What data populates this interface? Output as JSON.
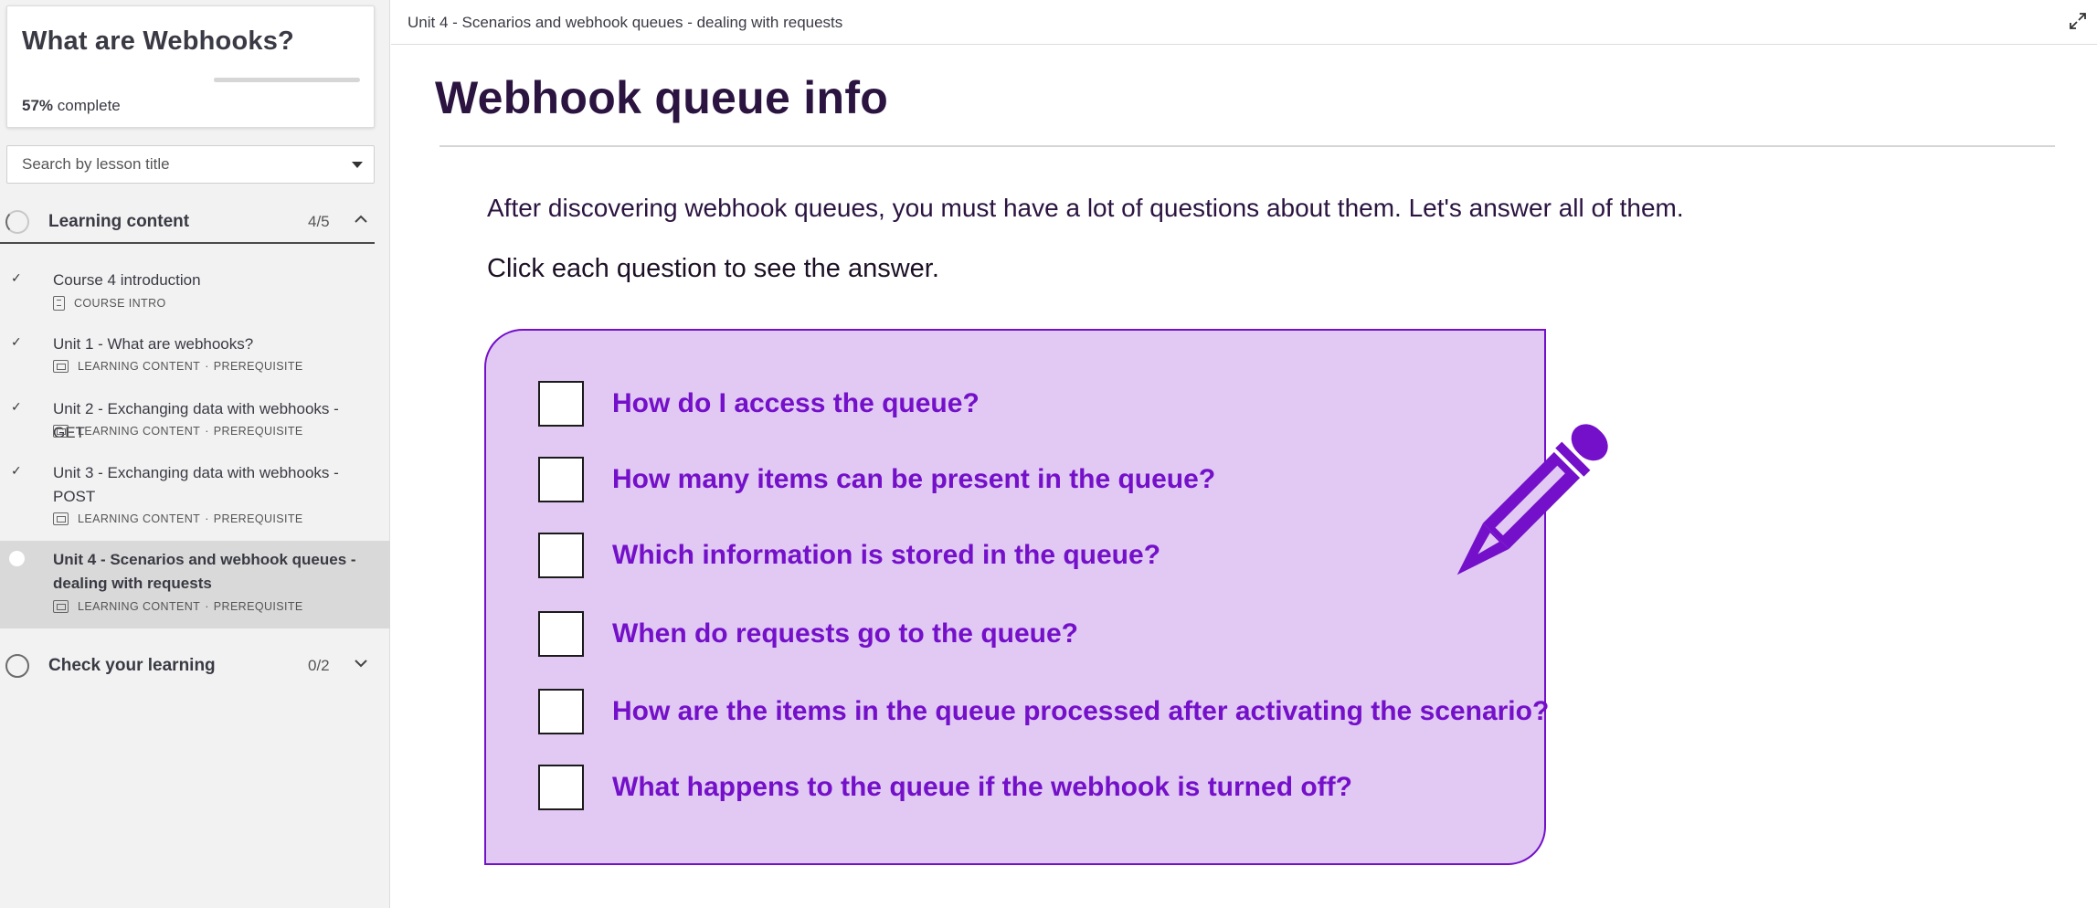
{
  "course": {
    "title": "What are Webhooks?",
    "progress_percent": 57,
    "progress_percent_label": "57%",
    "progress_suffix": "complete"
  },
  "search": {
    "placeholder": "Search by lesson title"
  },
  "sections": [
    {
      "title": "Learning content",
      "count": "4/5",
      "expanded": true,
      "lessons": [
        {
          "title": "Course 4 introduction",
          "type": "COURSE INTRO",
          "completed": true,
          "icon": "document-icon"
        },
        {
          "title": "Unit 1 - What are webhooks?",
          "type": "LEARNING CONTENT",
          "tag": "PREREQUISITE",
          "completed": true,
          "icon": "slides-icon"
        },
        {
          "title": "Unit 2 - Exchanging data with webhooks - GET",
          "type": "LEARNING CONTENT",
          "tag": "PREREQUISITE",
          "completed": true,
          "icon": "slides-icon"
        },
        {
          "title": "Unit 3 - Exchanging data with webhooks - POST",
          "type": "LEARNING CONTENT",
          "tag": "PREREQUISITE",
          "completed": true,
          "icon": "slides-icon"
        },
        {
          "title": "Unit 4 - Scenarios and webhook queues - dealing with requests",
          "type": "LEARNING CONTENT",
          "tag": "PREREQUISITE",
          "completed": false,
          "active": true,
          "icon": "slides-icon"
        }
      ]
    },
    {
      "title": "Check your learning",
      "count": "0/2",
      "expanded": false
    }
  ],
  "meta_separator": "·",
  "breadcrumb": "Unit 4 - Scenarios and webhook queues - dealing with requests",
  "main": {
    "title": "Webhook queue info",
    "intro": "After discovering webhook queues, you must have a lot of questions about them. Let's answer all of them.",
    "instruction": "Click each question to see the answer.",
    "questions": [
      "How do I access the queue?",
      "How many items can be present in the queue?",
      "Which information is stored in the queue?",
      "When do requests go to the queue?",
      "How are the items in the queue processed after activating the scenario?",
      "What happens to the queue if the webhook is turned off?"
    ]
  },
  "colors": {
    "accent": "#7410c9",
    "card_background": "#e2c9f3",
    "title": "#2b1440"
  },
  "icons": {
    "check": "check-icon",
    "expand": "expand-icon",
    "pencil": "pencil-icon",
    "chevron_up": "chevron-up-icon",
    "chevron_down": "chevron-down-icon"
  }
}
